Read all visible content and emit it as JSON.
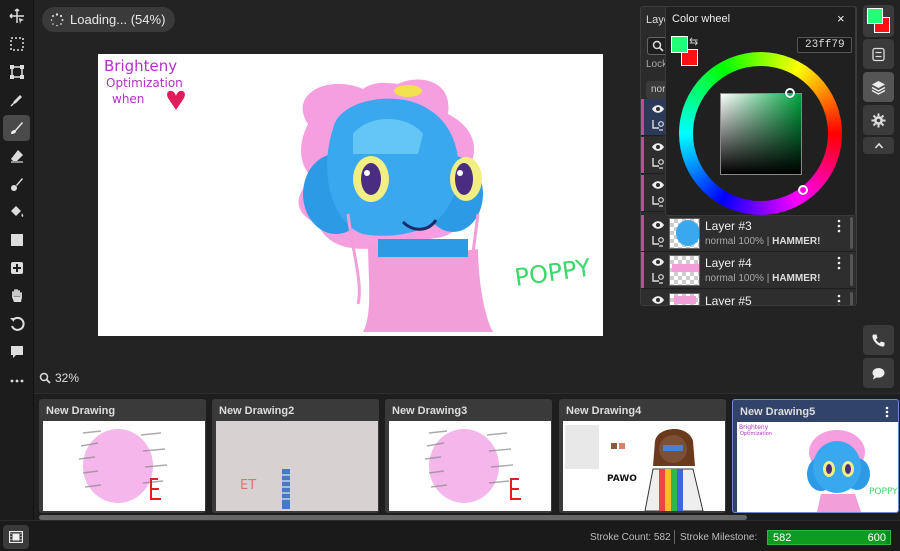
{
  "loading": {
    "text": "Loading... (54%)",
    "progress": 0.54
  },
  "zoom": {
    "label": "32%"
  },
  "canvas": {
    "annotation_line1": "Brighteny",
    "annotation_line2": "Optimization",
    "annotation_line3": "when",
    "signature": "POPPY"
  },
  "layers_panel": {
    "title": "Laye",
    "lock_label": "Lock",
    "blend_box": "nor",
    "rows": [
      {
        "name": "",
        "blend": "",
        "opacity": "",
        "tag": ""
      },
      {
        "name": "",
        "blend": "",
        "opacity": "",
        "tag": ""
      },
      {
        "name": "",
        "blend": "",
        "opacity": "",
        "tag": ""
      },
      {
        "name": "Layer #3",
        "blend": "normal",
        "opacity": "100%",
        "tag": "HAMMER!"
      },
      {
        "name": "Layer #4",
        "blend": "normal",
        "opacity": "100%",
        "tag": "HAMMER!"
      },
      {
        "name": "Layer #5",
        "blend": "",
        "opacity": "",
        "tag": ""
      }
    ]
  },
  "color_wheel": {
    "title": "Color wheel",
    "close_glyph": "×",
    "swap_glyph": "⇆",
    "hex": "23ff79",
    "primary_color": "#23ff79",
    "secondary_color": "#ff1010"
  },
  "drawings": [
    {
      "title": "New Drawing"
    },
    {
      "title": "New Drawing2"
    },
    {
      "title": "New Drawing3"
    },
    {
      "title": "New Drawing4"
    },
    {
      "title": "New Drawing5"
    }
  ],
  "thumb_text": {
    "d2_label": "ET",
    "d4_label": "PAWO",
    "d5_line1": "Brighteny",
    "d5_line2": "Optimization",
    "d5_signature": "POPPY"
  },
  "status": {
    "stroke_count": "Stroke Count: 582",
    "milestone_label": "Stroke Milestone:",
    "milestone_value": "582",
    "milestone_max": "600",
    "milestone_fraction": 0.97
  },
  "colors": {
    "accent_blue": "#314368",
    "milestone_green": "#0f9b1f",
    "layer_marker_pink": "#c54a93"
  }
}
